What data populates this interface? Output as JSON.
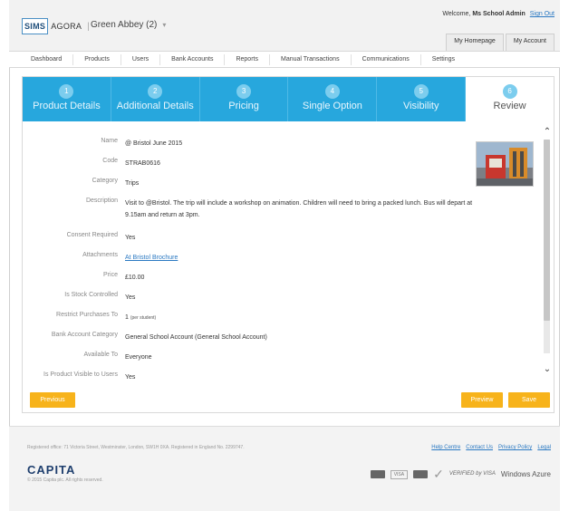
{
  "header": {
    "logo_sims": "SIMS",
    "logo_agora": "AGORA",
    "school": "Green Abbey (2)",
    "welcome_prefix": "Welcome,",
    "user": "Ms School Admin",
    "sign_out": "Sign Out",
    "tabs": [
      "My Homepage",
      "My Account"
    ]
  },
  "nav": [
    "Dashboard",
    "Products",
    "Users",
    "Bank Accounts",
    "Reports",
    "Manual Transactions",
    "Communications",
    "Settings"
  ],
  "steps": [
    {
      "num": "1",
      "label": "Product Details"
    },
    {
      "num": "2",
      "label": "Additional Details"
    },
    {
      "num": "3",
      "label": "Pricing"
    },
    {
      "num": "4",
      "label": "Single Option"
    },
    {
      "num": "5",
      "label": "Visibility"
    },
    {
      "num": "6",
      "label": "Review"
    }
  ],
  "review": {
    "name": {
      "label": "Name",
      "value": "@ Bristol June 2015"
    },
    "code": {
      "label": "Code",
      "value": "STRAB0616"
    },
    "category": {
      "label": "Category",
      "value": "Trips"
    },
    "description": {
      "label": "Description",
      "value": "Visit to @Bristol. The trip will include a workshop on animation. Children will need to bring a packed lunch. Bus will depart at",
      "value2": "9.15am and return at 3pm."
    },
    "consent": {
      "label": "Consent Required",
      "value": "Yes"
    },
    "attachments": {
      "label": "Attachments",
      "value": "At Bristol Brochure"
    },
    "price": {
      "label": "Price",
      "value": "£10.00"
    },
    "stock": {
      "label": "Is Stock Controlled",
      "value": "Yes"
    },
    "restrict": {
      "label": "Restrict Purchases To",
      "value": "1",
      "note": "(per student)"
    },
    "bank": {
      "label": "Bank Account Category",
      "value": "General School Account (General School Account)"
    },
    "available": {
      "label": "Available To",
      "value": "Everyone"
    },
    "visible": {
      "label": "Is Product Visible to Users",
      "value": "Yes"
    }
  },
  "buttons": {
    "previous": "Previous",
    "preview": "Preview",
    "save": "Save"
  },
  "footer": {
    "registered": "Registered office: 71 Victoria Street, Westminster, London, SW1H 0XA. Registered in England No. 2299747.",
    "links": [
      "Help Centre",
      "Contact Us",
      "Privacy Policy",
      "Legal"
    ],
    "brand": "CAPITA",
    "copyright": "© 2015 Capita plc. All rights reserved.",
    "badge_visa": "VISA",
    "badge_verified": "VERIFIED by VISA",
    "badge_windows": "Windows Azure"
  },
  "colors": {
    "accent": "#27a7dd",
    "button": "#f7b31b",
    "link": "#2b79c2"
  }
}
